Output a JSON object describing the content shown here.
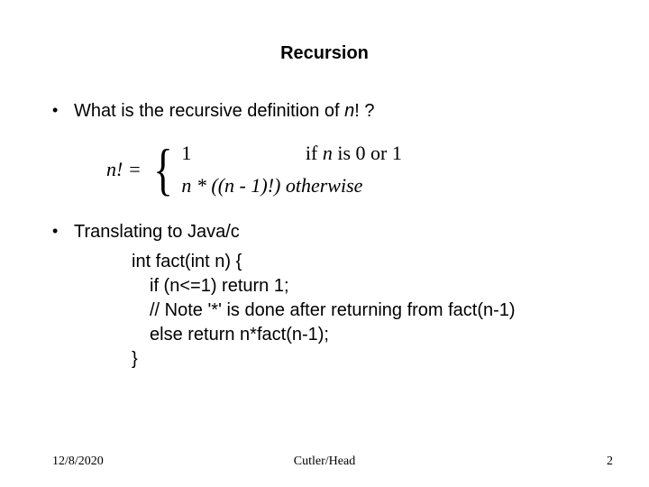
{
  "title": "Recursion",
  "bullet1_prefix": "What is the recursive definition of ",
  "bullet1_n": "n",
  "bullet1_suffix": "! ?",
  "formula": {
    "lhs": "n! =",
    "brace": "{",
    "case1_val": "1",
    "case1_cond_prefix": "if ",
    "case1_cond_n": "n",
    "case1_cond_rest": " is 0 or 1",
    "case2_expr": "n * ((n - 1)!)",
    "case2_cond": " otherwise"
  },
  "bullet2": "Translating to Java/c",
  "code": {
    "l1": "int fact(int n) {",
    "l2": "if (n<=1) return 1;",
    "l3": "// Note '*' is done after returning from fact(n-1)",
    "l4": "else return n*fact(n-1);",
    "l5": "}"
  },
  "footer": {
    "date": "12/8/2020",
    "center": "Cutler/Head",
    "page": "2"
  }
}
